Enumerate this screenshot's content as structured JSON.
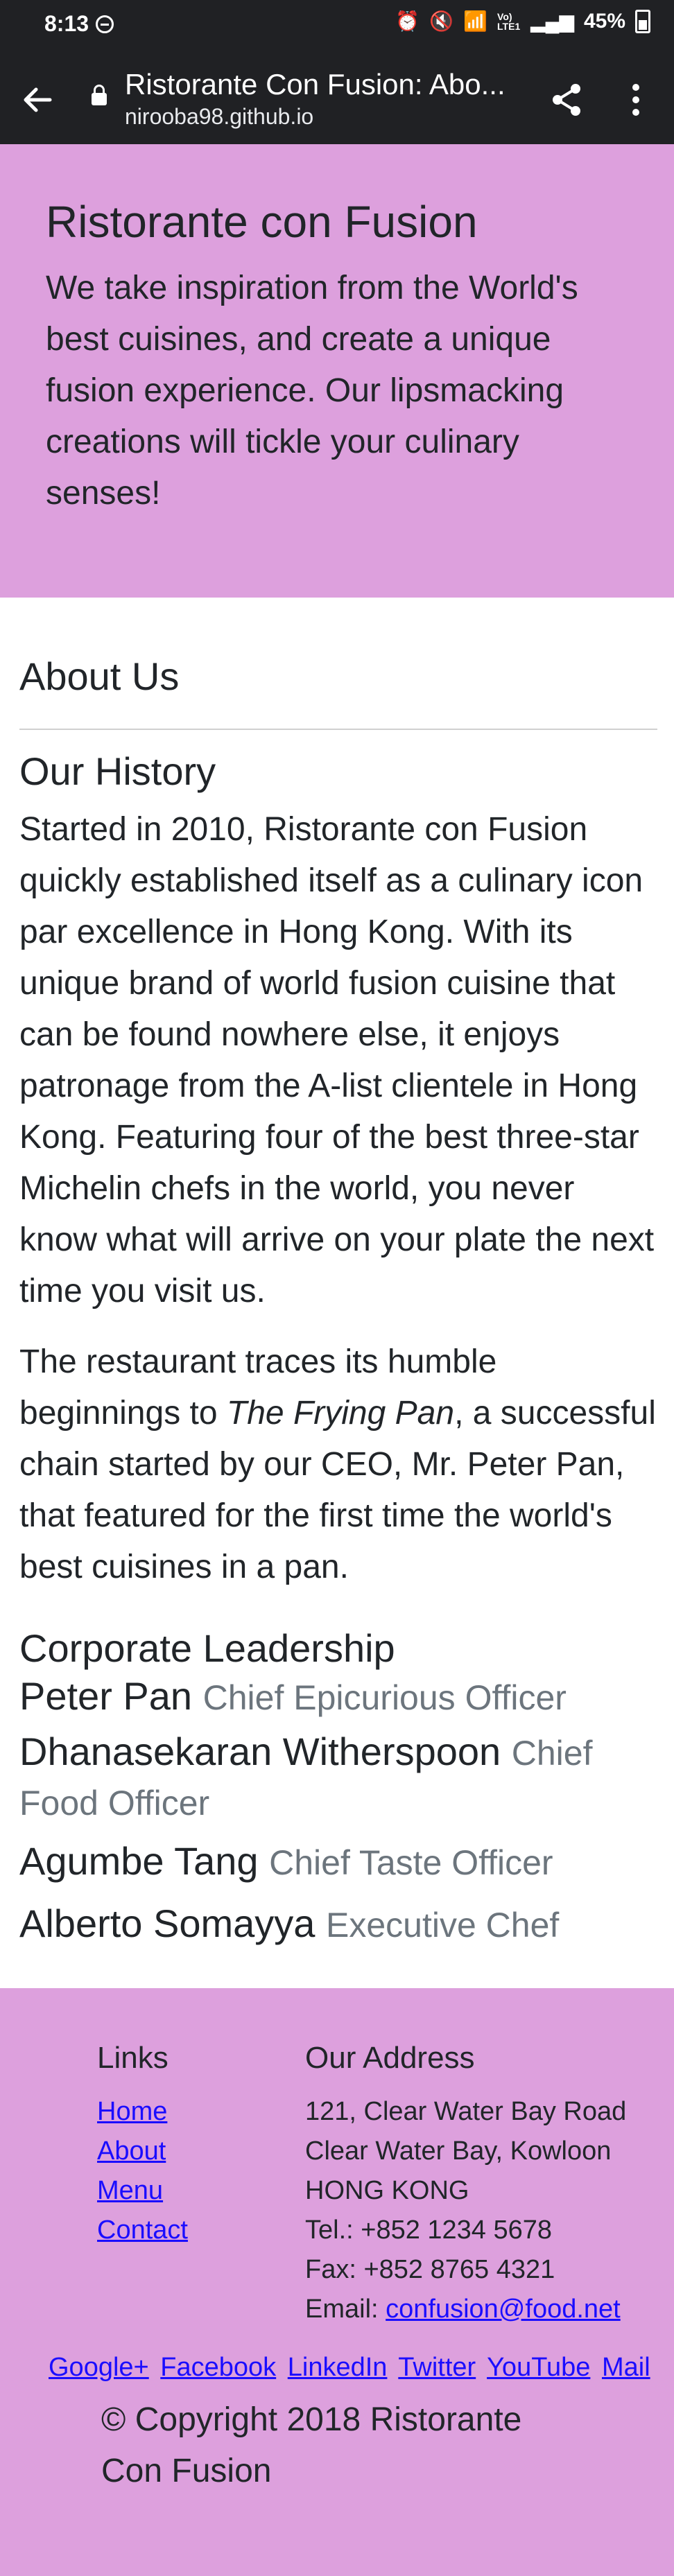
{
  "status_bar": {
    "time": "8:13",
    "signal_label": "Vo) LTE1",
    "battery": "45%"
  },
  "browser": {
    "page_title": "Ristorante Con Fusion: Abo...",
    "url": "nirooba98.github.io"
  },
  "jumbotron": {
    "title": "Ristorante con Fusion",
    "text": "We take inspiration from the World's best cuisines, and create a unique fusion experience. Our lipsmacking creations will tickle your culinary senses!"
  },
  "main": {
    "about_title": "About Us",
    "history_title": "Our History",
    "history_p1": "Started in 2010, Ristorante con Fusion quickly established itself as a culinary icon par excellence in Hong Kong. With its unique brand of world fusion cuisine that can be found nowhere else, it enjoys patronage from the A-list clientele in Hong Kong. Featuring four of the best three-star Michelin chefs in the world, you never know what will arrive on your plate the next time you visit us.",
    "history_p2_before": "The restaurant traces its humble beginnings to ",
    "history_p2_em": "The Frying Pan",
    "history_p2_after": ", a successful chain started by our CEO, Mr. Peter Pan, that featured for the first time the world's best cuisines in a pan.",
    "leadership_title": "Corporate Leadership",
    "leaders": [
      {
        "name": "Peter Pan",
        "role": "Chief Epicurious Officer"
      },
      {
        "name": "Dhanasekaran Witherspoon",
        "role": "Chief Food Officer"
      },
      {
        "name": "Agumbe Tang",
        "role": "Chief Taste Officer"
      },
      {
        "name": "Alberto Somayya",
        "role": "Executive Chef"
      }
    ]
  },
  "footer": {
    "links_title": "Links",
    "links": [
      "Home",
      "About",
      "Menu",
      "Contact"
    ],
    "address_title": "Our Address",
    "address_lines": [
      "121, Clear Water Bay Road",
      "Clear Water Bay, Kowloon",
      "HONG KONG",
      "Tel.: +852 1234 5678",
      "Fax: +852 8765 4321"
    ],
    "email_label": "Email: ",
    "email": "confusion@food.net",
    "social": [
      "Google+",
      "Facebook",
      "LinkedIn",
      "Twitter",
      "YouTube",
      "Mail"
    ],
    "copyright": "© Copyright 2018 Ristorante Con Fusion"
  },
  "colors": {
    "purple_bg": "#dda0dd",
    "chrome_dark": "#202124",
    "link": "#1a0dff",
    "muted": "#6c757d"
  }
}
